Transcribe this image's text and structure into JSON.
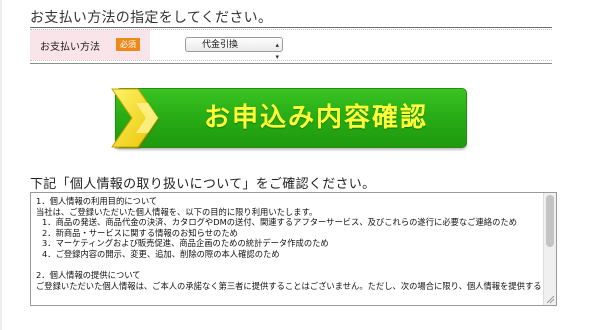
{
  "payment_section": {
    "title": "お支払い方法の指定をしてください。",
    "label": "お支払い方法",
    "required_badge": "必須",
    "selected_option": "代金引換"
  },
  "confirm_button": {
    "label": "お申込み内容確認"
  },
  "privacy": {
    "heading": "下記「個人情報の取り扱いについて」をご確認ください。",
    "lines": [
      "1．個人情報の利用目的について",
      "当社は、ご登録いただいた個人情報を、以下の目的に限り利用いたします。",
      "1．商品の発送、商品代金の決済、カタログやDMの送付、関連するアフターサービス、及びこれらの遂行に必要なご連絡のため",
      "2．新商品・サービスに関する情報のお知らせのため",
      "3．マーケティングおよび販売促進、商品企画のための統計データ作成のため",
      "4．ご登録内容の開示、変更、追加、削除の際の本人確認のため",
      "",
      "2．個人情報の提供について",
      "ご登録いただいた個人情報は、ご本人の承諾なく第三者に提供することはございません。ただし、次の場合に限り、個人情報を提供する"
    ]
  },
  "colors": {
    "button_green": "#29ad16",
    "button_text": "#ffff3a",
    "required_badge": "#ee8a1c",
    "label_cell": "#f9e4ea"
  }
}
